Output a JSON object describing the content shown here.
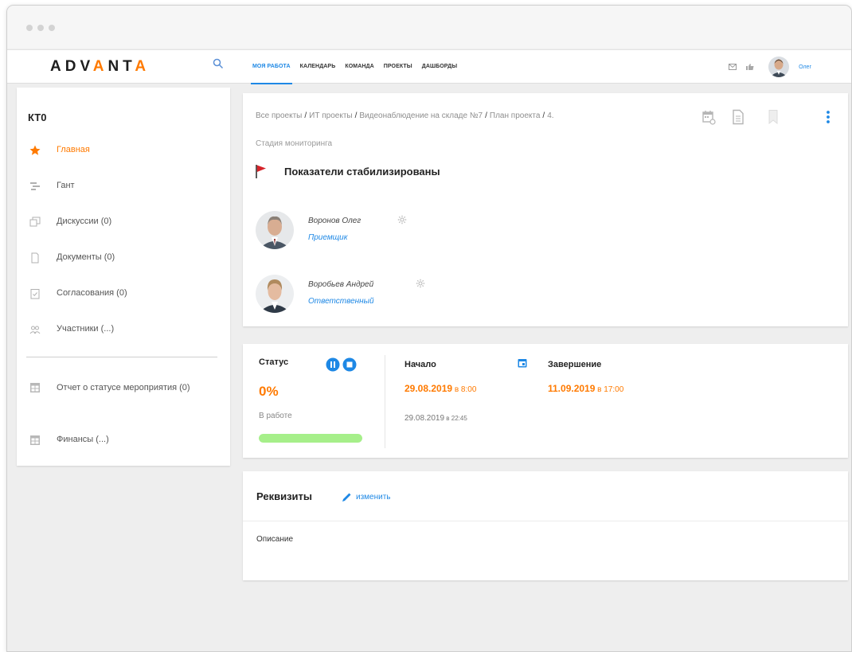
{
  "navbar": {
    "logo": {
      "part1": "ADV",
      "accent1": "A",
      "part2": "NT",
      "accent2": "A"
    },
    "items": [
      {
        "label": "МОЯ РАБОТА"
      },
      {
        "label": "КАЛЕНДАРЬ"
      },
      {
        "label": "КОМАНДА"
      },
      {
        "label": "ПРОЕКТЫ"
      },
      {
        "label": "ДАШБОРДЫ"
      }
    ],
    "user_name": "Олег"
  },
  "sidebar": {
    "title": "КТ0",
    "items": [
      {
        "label": "Главная",
        "icon": "star-icon"
      },
      {
        "label": "Гант",
        "icon": "gantt-icon"
      },
      {
        "label": "Дискуссии (0)",
        "icon": "discussion-icon"
      },
      {
        "label": "Документы (0)",
        "icon": "document-icon"
      },
      {
        "label": "Согласования (0)",
        "icon": "approval-icon"
      },
      {
        "label": "Участники (...)",
        "icon": "participants-icon"
      }
    ],
    "reports": [
      {
        "label": "Отчет о статусе мероприятия (0)",
        "icon": "table-icon"
      },
      {
        "label": "Финансы (...)",
        "icon": "table-icon"
      }
    ]
  },
  "task": {
    "breadcrumb": [
      "Все проекты",
      "ИТ проекты",
      "Видеонаблюдение на складе №7",
      "План проекта",
      "4."
    ],
    "stage": "Стадия мониторинга",
    "title": "Показатели стабилизированы",
    "people": [
      {
        "name": "Воронов Олег",
        "role": "Приемщик"
      },
      {
        "name": "Воробьев Андрей",
        "role": "Ответственный"
      }
    ]
  },
  "status": {
    "label": "Статус",
    "percent": "0%",
    "progress": 0.0,
    "state": "В работе",
    "start_label": "Начало",
    "start_date": "29.08.2019",
    "start_time": " в 8:00",
    "actual_start": "29.08.2019",
    "actual_time": " в 22:45",
    "end_label": "Завершение",
    "end_date": "11.09.2019",
    "end_time": " в 17:00"
  },
  "details": {
    "title": "Реквизиты",
    "edit_label": "изменить",
    "description_label": "Описание"
  },
  "colors": {
    "accent": "#ff7a00",
    "link": "#1e88e5",
    "progress": "#a6ef8a"
  }
}
